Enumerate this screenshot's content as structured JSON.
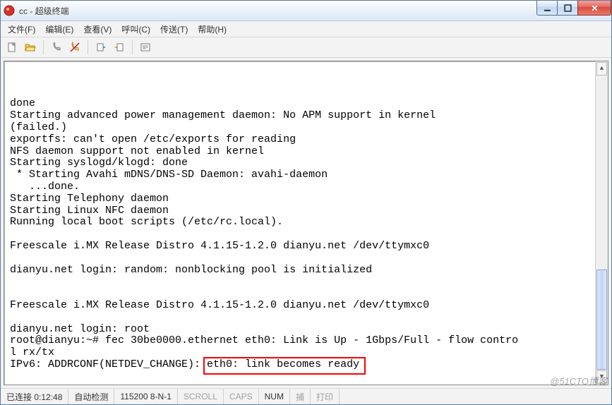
{
  "window": {
    "title": "cc - 超级终端"
  },
  "menu": {
    "file": "文件(F)",
    "edit": "编辑(E)",
    "view": "查看(V)",
    "call": "呼叫(C)",
    "transfer": "传送(T)",
    "help": "帮助(H)"
  },
  "toolbar_icons": {
    "new": "new-file-icon",
    "open": "open-folder-icon",
    "connect": "phone-connect-icon",
    "disconnect": "phone-disconnect-icon",
    "send": "send-file-icon",
    "receive": "receive-file-icon",
    "properties": "properties-icon"
  },
  "terminal_lines": [
    "done",
    "Starting advanced power management daemon: No APM support in kernel",
    "(failed.)",
    "exportfs: can't open /etc/exports for reading",
    "NFS daemon support not enabled in kernel",
    "Starting syslogd/klogd: done",
    " * Starting Avahi mDNS/DNS-SD Daemon: avahi-daemon",
    "   ...done.",
    "Starting Telephony daemon",
    "Starting Linux NFC daemon",
    "Running local boot scripts (/etc/rc.local).",
    "",
    "Freescale i.MX Release Distro 4.1.15-1.2.0 dianyu.net /dev/ttymxc0",
    "",
    "dianyu.net login: random: nonblocking pool is initialized",
    "",
    "",
    "Freescale i.MX Release Distro 4.1.15-1.2.0 dianyu.net /dev/ttymxc0",
    "",
    "dianyu.net login: root",
    "root@dianyu:~# fec 30be0000.ethernet eth0: Link is Up - 1Gbps/Full - flow contro",
    "l rx/tx",
    "IPv6: ADDRCONF(NETDEV_CHANGE): eth0: link becomes ready"
  ],
  "highlight": {
    "text": "eth0: link becomes ready"
  },
  "status": {
    "connected": "已连接 0:12:48",
    "auto": "自动检测",
    "serial": "115200 8-N-1",
    "scroll": "SCROLL",
    "caps": "CAPS",
    "num": "NUM",
    "capture": "捕",
    "print": "打印"
  },
  "watermark": "@51CTO博客"
}
